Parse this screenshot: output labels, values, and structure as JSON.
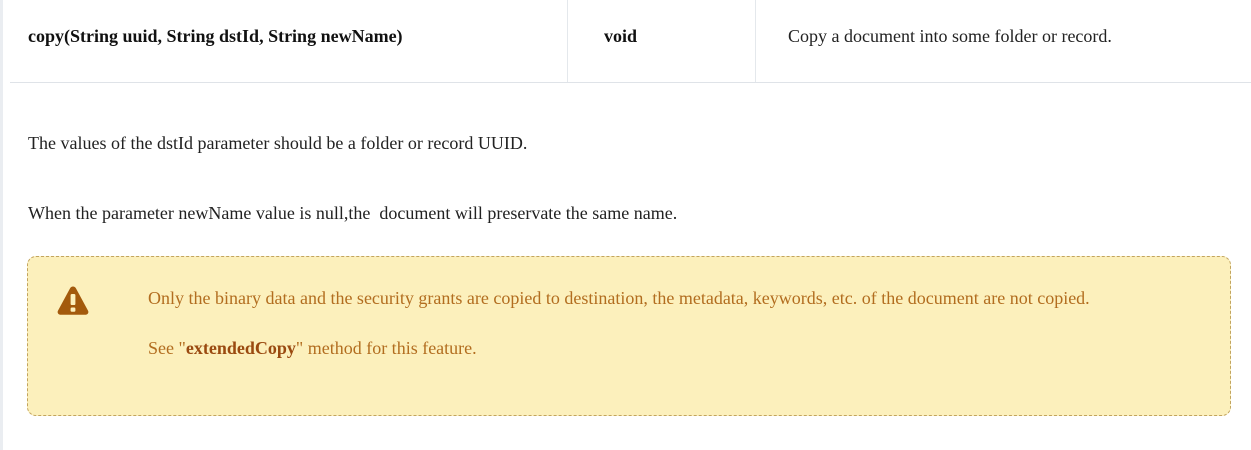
{
  "method_table": {
    "signature": "copy(String uuid, String dstId, String newName)",
    "return_type": "void",
    "description": "Copy a document into some folder or record."
  },
  "paragraphs": [
    "The values of the dstId parameter should be a folder or record UUID.",
    "When the parameter newName value is null,the  document will preservate the same name."
  ],
  "warning": {
    "icon": "warning-triangle-icon",
    "text_1": "Only the binary data and the security grants are copied to destination, the metadata, keywords, etc. of the document are not copied.",
    "see_prefix": "See \"",
    "see_link": "extendedCopy",
    "see_suffix": "\" method for this feature."
  },
  "colors": {
    "warning_background": "#fcf0bc",
    "warning_border": "#c2a45f",
    "warning_text": "#b26d1f",
    "warning_icon": "#a35a0c"
  }
}
